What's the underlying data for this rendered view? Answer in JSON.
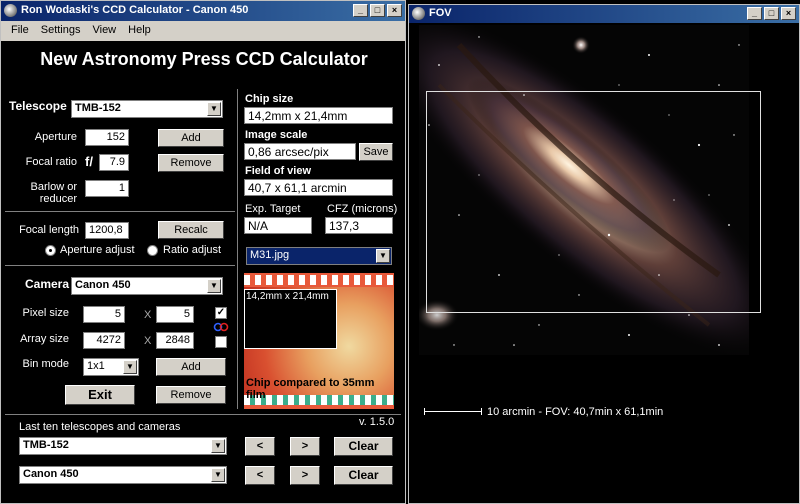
{
  "calc_window": {
    "title": "Ron Wodaski's CCD Calculator - Canon 450",
    "menu": [
      "File",
      "Settings",
      "View",
      "Help"
    ],
    "header": "New Astronomy Press CCD Calculator",
    "telescope": {
      "label": "Telescope",
      "selected": "TMB-152",
      "aperture_label": "Aperture",
      "aperture": "152",
      "focal_ratio_label": "Focal ratio",
      "f_prefix": "f/",
      "focal_ratio": "7.9",
      "barlow_label_1": "Barlow or",
      "barlow_label_2": "reducer",
      "barlow": "1",
      "add_label": "Add",
      "remove_label": "Remove",
      "focal_length_label": "Focal length",
      "focal_length": "1200,8",
      "recalc_label": "Recalc",
      "aperture_adjust_label": "Aperture adjust",
      "ratio_adjust_label": "Ratio adjust"
    },
    "camera": {
      "label": "Camera",
      "selected": "Canon 450",
      "pixel_size_label": "Pixel size",
      "pixel_x": "5",
      "pixel_y": "5",
      "array_size_label": "Array size",
      "array_x": "4272",
      "array_y": "2848",
      "times": "X",
      "bin_mode_label": "Bin mode",
      "bin_mode": "1x1",
      "add_label": "Add",
      "remove_label": "Remove",
      "exit_label": "Exit"
    },
    "results": {
      "chip_size_label": "Chip size",
      "chip_size": "14,2mm x 21,4mm",
      "image_scale_label": "Image scale",
      "image_scale": "0,86 arcsec/pix",
      "save_label": "Save",
      "fov_label": "Field of view",
      "fov": "40,7 x 61,1 arcmin",
      "exp_target_label": "Exp. Target",
      "exp_target": "N/A",
      "cfz_label": "CFZ (microns)",
      "cfz": "137,3",
      "image_select": "M31.jpg"
    },
    "film_preview": {
      "chip_label": "14,2mm x 21,4mm",
      "caption": "Chip compared to 35mm film"
    },
    "version": "v. 1.5.0",
    "last_ten_label": "Last ten telescopes and cameras",
    "recent_telescope": "TMB-152",
    "recent_camera": "Canon 450",
    "prev_label": "<",
    "next_label": ">",
    "clear_label": "Clear"
  },
  "fov_window": {
    "title": "FOV",
    "scale_text": "10 arcmin - FOV: 40,7min x 61,1min"
  },
  "colors": {
    "titlebar": "#0a246a",
    "app_bg": "#000000",
    "film_strip": "#e8593a"
  }
}
